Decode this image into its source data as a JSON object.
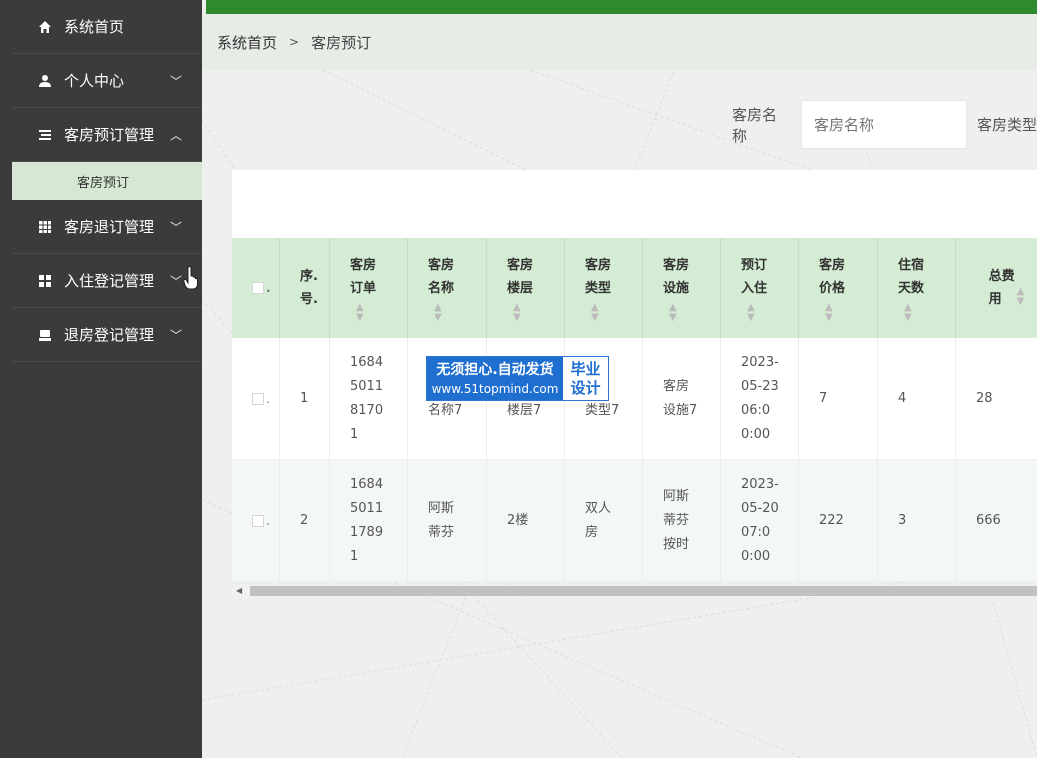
{
  "sidebar": {
    "items": [
      {
        "label": "系统首页",
        "icon": "home-icon",
        "chevron": ""
      },
      {
        "label": "个人中心",
        "icon": "user-icon",
        "chevron": "﹀"
      },
      {
        "label": "客房预订管理",
        "icon": "list-icon",
        "chevron": "︿"
      },
      {
        "label": "客房退订管理",
        "icon": "grid-icon",
        "chevron": "﹀"
      },
      {
        "label": "入住登记管理",
        "icon": "apps-icon",
        "chevron": "﹀"
      },
      {
        "label": "退房登记管理",
        "icon": "printer-icon",
        "chevron": "﹀"
      }
    ],
    "sub_items": [
      {
        "label": "客房预订"
      }
    ]
  },
  "breadcrumb": {
    "home": "系统首页",
    "sep": ">",
    "current": "客房预订"
  },
  "search": {
    "label": "客房名称",
    "placeholder": "客房名称",
    "label2": "客房类型"
  },
  "table": {
    "headers": [
      "序.\n号.",
      "客房\n订单",
      "客房\n名称",
      "客房\n楼层",
      "客房\n类型",
      "客房\n设施",
      "预订\n入住",
      "客房\n价格",
      "住宿\n天数",
      "总费\n用"
    ],
    "rows": [
      {
        "index": "1",
        "order": "1684\n5011\n8170\n1",
        "name": "\n名称7",
        "floor": "\n楼层7",
        "type": "\n类型7",
        "facility": "客房\n设施7",
        "checkin": "2023-\n05-23\n06:0\n0:00",
        "price": "7",
        "days": "4",
        "total": "28"
      },
      {
        "index": "2",
        "order": "1684\n5011\n1789\n1",
        "name": "阿斯\n蒂芬",
        "floor": "2楼",
        "type": "双人\n房",
        "facility": "阿斯\n蒂芬\n按时",
        "checkin": "2023-\n05-20\n07:0\n0:00",
        "price": "222",
        "days": "3",
        "total": "666"
      }
    ]
  },
  "watermark": {
    "line1": "无须担心.自动发货",
    "line2": "www.51topmind.com",
    "right1": "毕业",
    "right2": "设计"
  },
  "colors": {
    "topbar": "#2f8a2f",
    "sidebar": "#3b3b3b",
    "header": "#d3ecd3",
    "submenu": "#d6e8d4"
  }
}
